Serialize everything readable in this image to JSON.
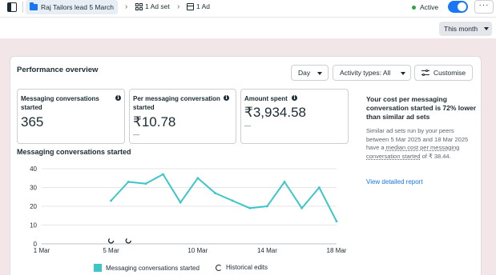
{
  "topbar": {
    "campaign_label": "Raj Tailors lead 5 March",
    "adset_label": "1 Ad set",
    "ad_label": "1 Ad",
    "status_label": "Active",
    "more_label": "···",
    "toggle_on": true
  },
  "date_filter": {
    "label": "This month"
  },
  "performance": {
    "title": "Performance overview",
    "controls": {
      "day_label": "Day",
      "activity_label": "Activity types: All",
      "customise_label": "Customise"
    },
    "metrics": [
      {
        "label": "Messaging conversations started",
        "value": "365",
        "subtext": ""
      },
      {
        "label": "Per messaging conversation started",
        "value": "₹10.78",
        "subtext": "—"
      },
      {
        "label": "Amount spent",
        "value": "₹3,934.58",
        "subtext": "—"
      }
    ],
    "info_icon": "i"
  },
  "insight": {
    "title": "Your cost per messaging conversation started is 72% lower than similar ad sets",
    "body_prefix": "Similar ad sets run by your peers between 5 Mar 2025 and 18 Mar 2025 have a ",
    "body_link": "median cost per messaging conversation started",
    "body_suffix": " of ₹ 38.44.",
    "link_label": "View detailed report"
  },
  "chart_title": "Messaging conversations started",
  "legend": {
    "series_label": "Messaging conversations started",
    "edits_label": "Historical edits"
  },
  "colors": {
    "series": "#3ec6c6",
    "accent": "#1877f2",
    "active": "#31a24c"
  },
  "chart_data": {
    "type": "line",
    "title": "Messaging conversations started",
    "x": [
      "5 Mar",
      "6 Mar",
      "7 Mar",
      "8 Mar",
      "9 Mar",
      "10 Mar",
      "11 Mar",
      "12 Mar",
      "13 Mar",
      "14 Mar",
      "15 Mar",
      "16 Mar",
      "17 Mar",
      "18 Mar"
    ],
    "x_ticks": [
      "1 Mar",
      "5 Mar",
      "10 Mar",
      "14 Mar",
      "18 Mar"
    ],
    "y_ticks": [
      0,
      10,
      20,
      30,
      40
    ],
    "ylim": [
      0,
      40
    ],
    "series": [
      {
        "name": "Messaging conversations started",
        "values": [
          23,
          33,
          32,
          37,
          22,
          35,
          27,
          23,
          19,
          20,
          33,
          19,
          30,
          12
        ]
      }
    ],
    "historical_edits": [
      "5 Mar",
      "6 Mar"
    ],
    "grid": true,
    "legend_position": "bottom"
  }
}
